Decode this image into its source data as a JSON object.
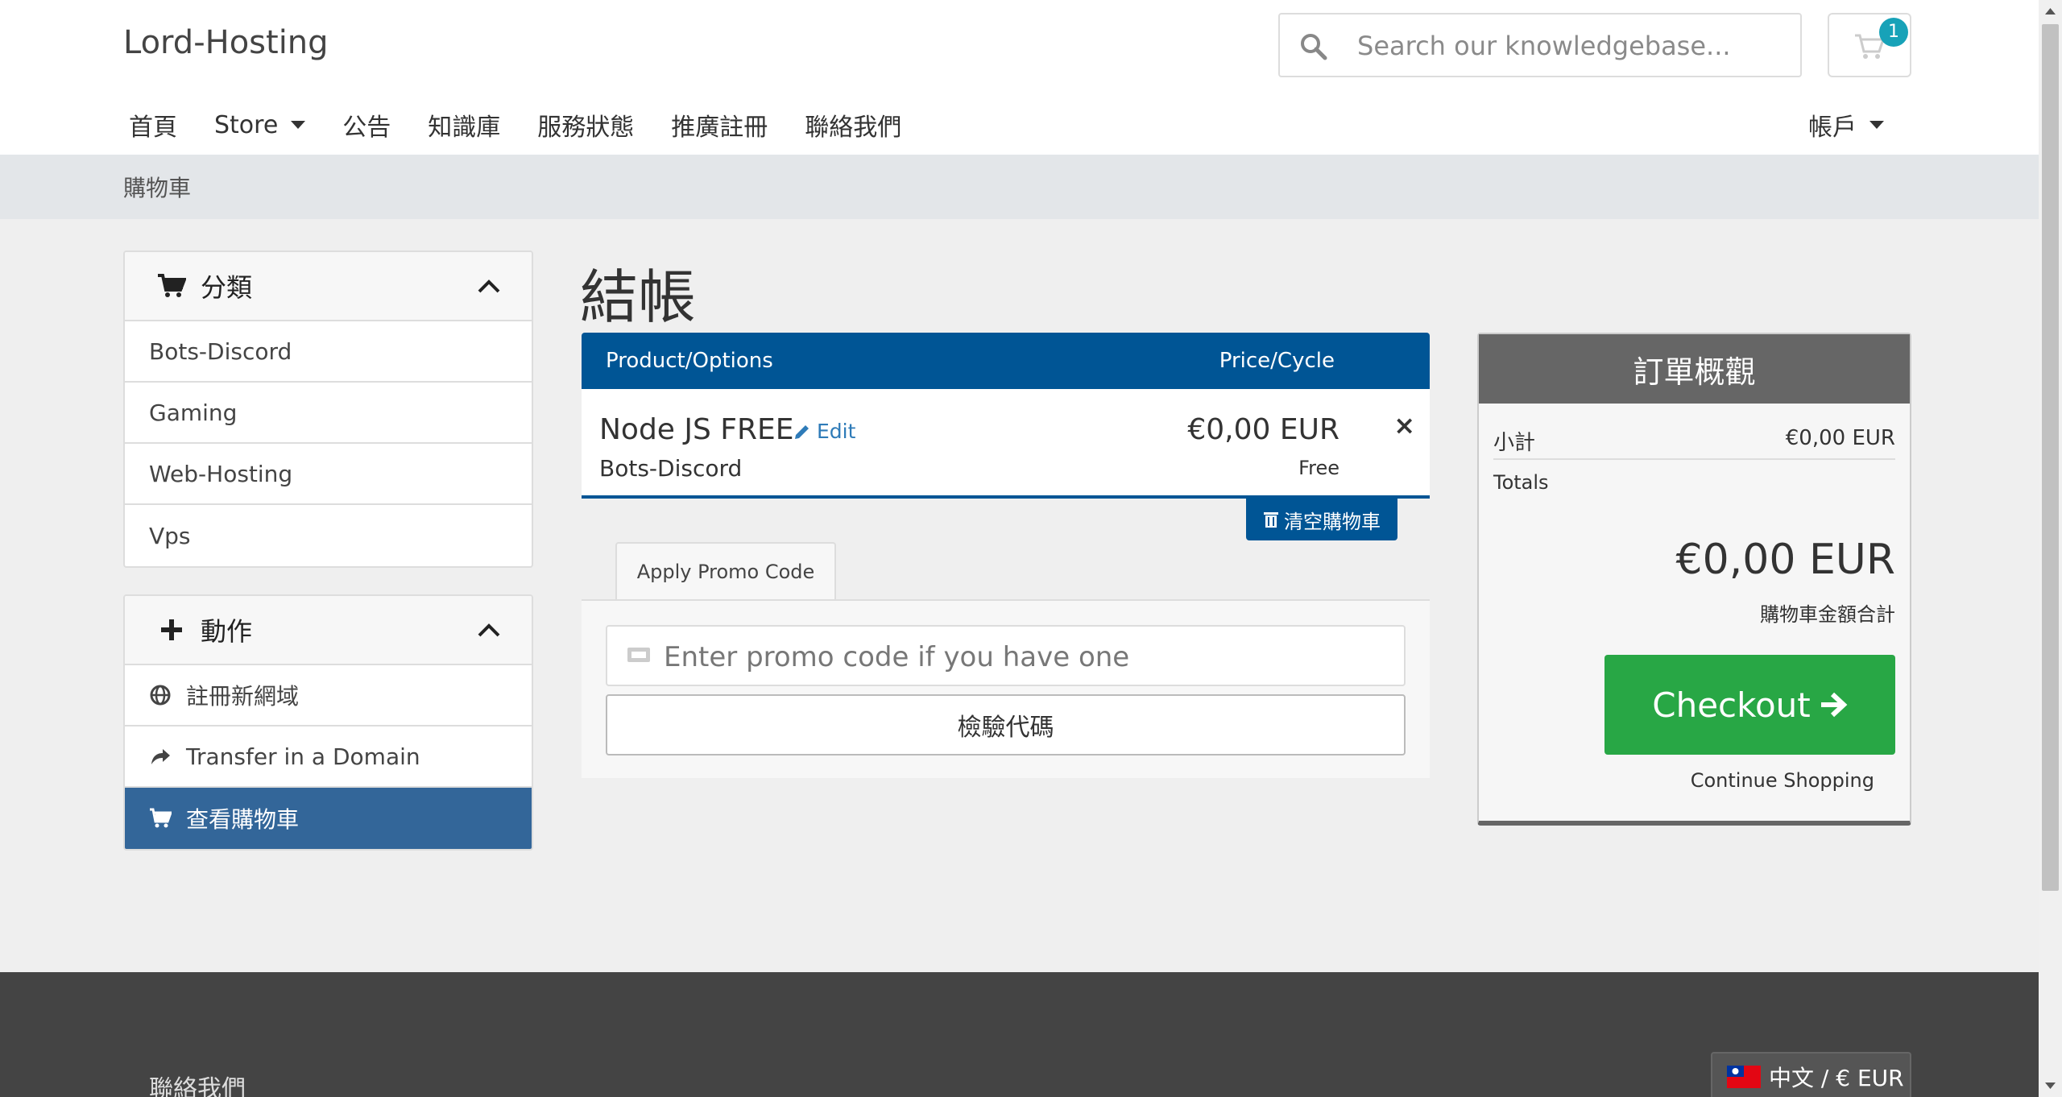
{
  "header": {
    "brand": "Lord-Hosting",
    "search_placeholder": "Search our knowledgebase...",
    "cart_count": "1",
    "nav": [
      {
        "label": "首頁"
      },
      {
        "label": "Store"
      },
      {
        "label": "公告"
      },
      {
        "label": "知識庫"
      },
      {
        "label": "服務狀態"
      },
      {
        "label": "推廣註冊"
      },
      {
        "label": "聯絡我們"
      }
    ],
    "account_label": "帳戶"
  },
  "breadcrumb": "購物車",
  "sidebar": {
    "categories": {
      "title": "分類",
      "items": [
        {
          "label": "Bots-Discord"
        },
        {
          "label": "Gaming"
        },
        {
          "label": "Web-Hosting"
        },
        {
          "label": "Vps"
        }
      ]
    },
    "actions": {
      "title": "動作",
      "items": [
        {
          "label": "註冊新網域",
          "icon": "globe-icon"
        },
        {
          "label": "Transfer in a Domain",
          "icon": "share-icon"
        },
        {
          "label": "查看購物車",
          "icon": "cart-icon",
          "active": true
        }
      ]
    }
  },
  "main": {
    "title": "結帳",
    "table": {
      "col_product": "Product/Options",
      "col_price": "Price/Cycle"
    },
    "item": {
      "name": "Node JS FREE",
      "edit_label": "Edit",
      "group": "Bots-Discord",
      "price": "€0,00 EUR",
      "cycle": "Free",
      "remove": "×"
    },
    "empty_cart_label": "清空購物車",
    "promo": {
      "tab_label": "Apply Promo Code",
      "placeholder": "Enter promo code if you have one",
      "validate_label": "檢驗代碼"
    }
  },
  "summary": {
    "title": "訂單概觀",
    "subtotal_label": "小計",
    "subtotal_value": "€0,00 EUR",
    "totals_label": "Totals",
    "total_amount": "€0,00 EUR",
    "total_caption": "購物車金額合計",
    "checkout_label": "Checkout",
    "continue_label": "Continue Shopping"
  },
  "footer": {
    "contact_label": "聯絡我們",
    "language_label": "中文 / € EUR"
  },
  "colors": {
    "primary_blue": "#005595",
    "active_blue": "#336699",
    "checkout_green": "#28a745",
    "badge_teal": "#17a2b8",
    "summary_header": "#666666",
    "footer_bg": "#444444"
  }
}
